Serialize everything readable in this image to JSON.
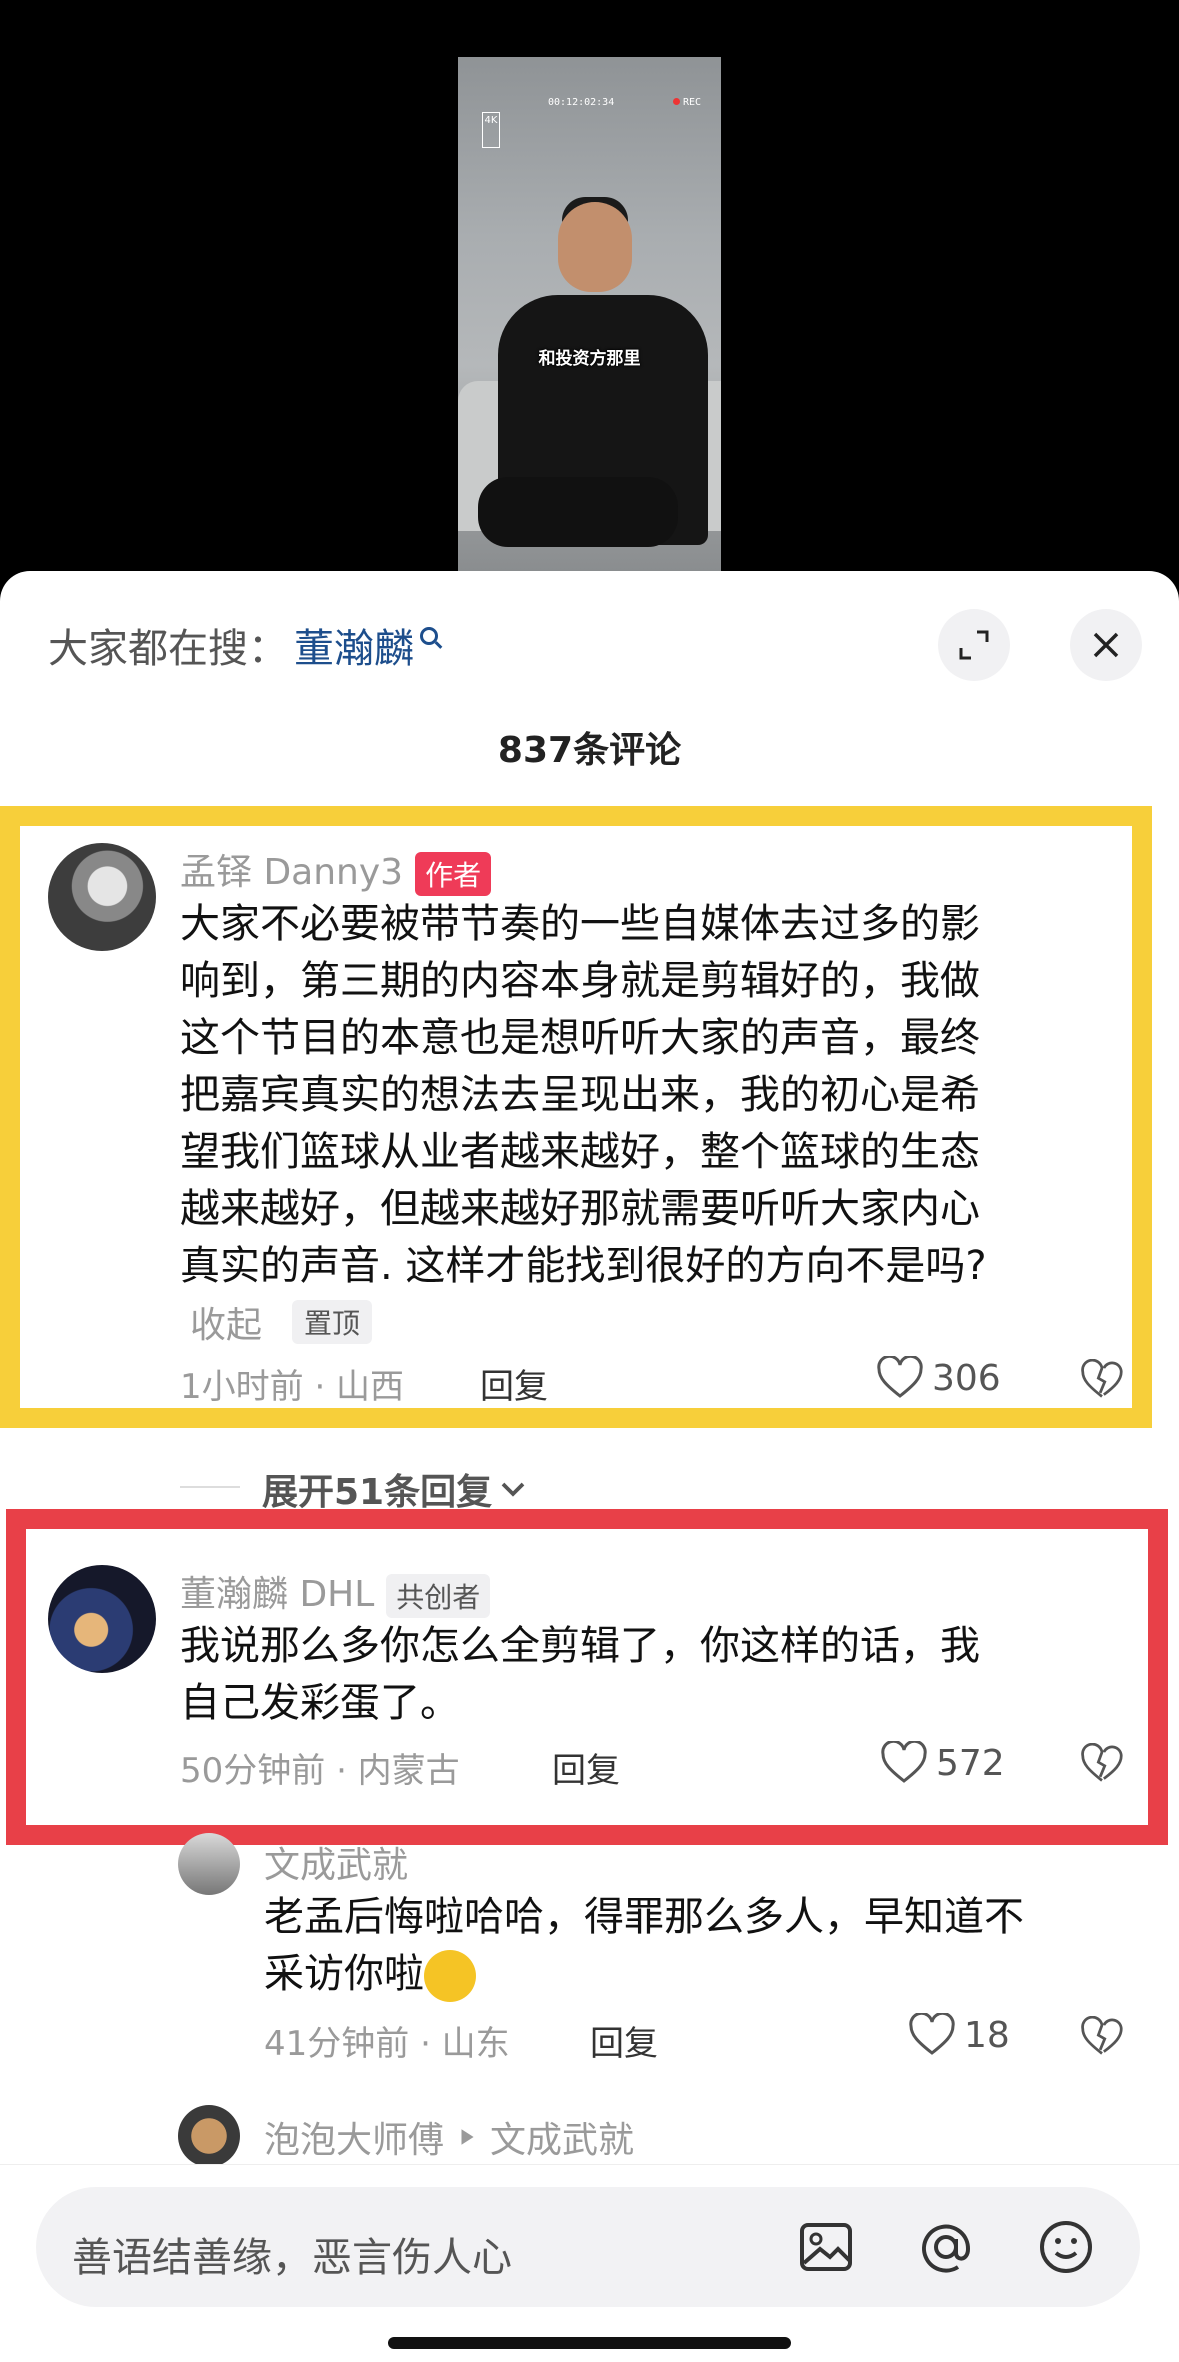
{
  "video": {
    "status_time": "00:12:02:34",
    "rec_label": "REC",
    "hd_label": "4K",
    "caption": "和投资方那里"
  },
  "panel": {
    "search_prefix": "大家都在搜：",
    "search_keyword": "董瀚麟",
    "comment_count": "837条评论"
  },
  "comments": [
    {
      "user": "孟铎 Danny3",
      "badge": "作者",
      "text_lines": [
        "大家不必要被带节奏的一些自媒体去过多的影",
        "响到，第三期的内容本身就是剪辑好的，我做",
        "这个节目的本意也是想听听大家的声音，最终",
        "把嘉宾真实的想法去呈现出来，我的初心是希",
        "望我们篮球从业者越来越好，整个篮球的生态",
        "越来越好，但越来越好那就需要听听大家内心",
        "真实的声音. 这样才能找到很好的方向不是吗?"
      ],
      "collapse_label": "收起",
      "pin_label": "置顶",
      "meta": "1小时前 · 山西",
      "reply_label": "回复",
      "likes": "306"
    },
    {
      "user": "董瀚麟 DHL",
      "badge": "共创者",
      "text_lines": [
        "我说那么多你怎么全剪辑了，你这样的话，我",
        "自己发彩蛋了。"
      ],
      "meta": "50分钟前 · 内蒙古",
      "reply_label": "回复",
      "likes": "572"
    }
  ],
  "expand_replies": "展开51条回复",
  "replies": [
    {
      "user": "文成武就",
      "text_lines": [
        "老孟后悔啦哈哈，得罪那么多人，早知道不",
        "采访你啦"
      ],
      "meta": "41分钟前 · 山东",
      "reply_label": "回复",
      "likes": "18"
    },
    {
      "user": "泡泡大师傅",
      "reply_to": "文成武就"
    }
  ],
  "input": {
    "placeholder": "善语结善缘，恶言伤人心"
  },
  "colors": {
    "highlight_yellow": "#f7cf3a",
    "highlight_red": "#e84048",
    "author_badge": "#ef3b58",
    "search_keyword": "#1d4e8c"
  }
}
